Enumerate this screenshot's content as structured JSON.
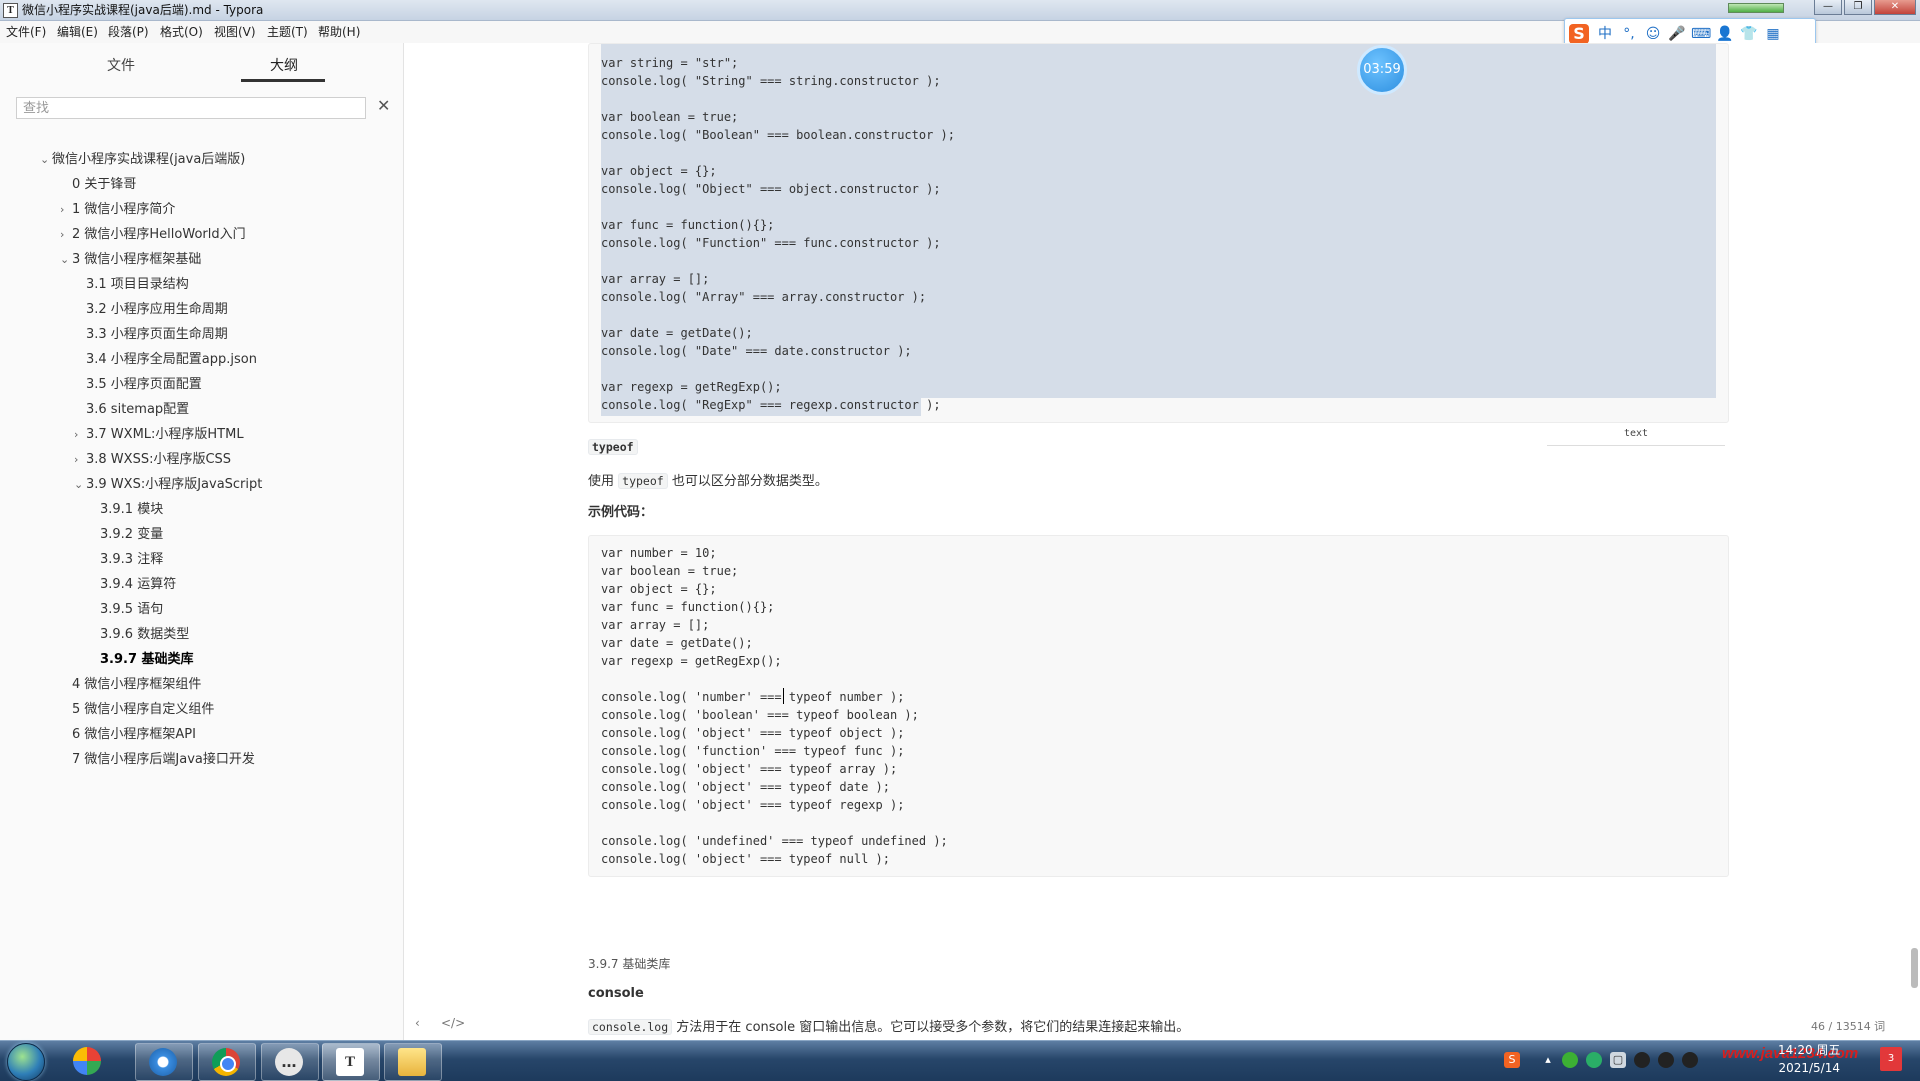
{
  "window": {
    "title": "微信小程序实战课程(java后端).md - Typora",
    "app_icon": "T",
    "controls": [
      "—",
      "❐",
      "✕"
    ]
  },
  "menu": [
    "文件(F)",
    "编辑(E)",
    "段落(P)",
    "格式(O)",
    "视图(V)",
    "主题(T)",
    "帮助(H)"
  ],
  "ime": {
    "items": [
      "S",
      "中",
      "°,",
      "☺",
      "🎤",
      "⌨",
      "👤",
      "👕",
      "▦"
    ]
  },
  "sidebar": {
    "tabs": [
      "文件",
      "大纲"
    ],
    "active_tab": "大纲",
    "search_placeholder": "查找",
    "search_clear": "✕",
    "outline": [
      {
        "label": "微信小程序实战课程(java后端版)",
        "level": 0,
        "chevron": "⌄"
      },
      {
        "label": "0 关于锋哥",
        "level": 1,
        "chevron": ""
      },
      {
        "label": "1 微信小程序简介",
        "level": 1,
        "chevron": "›"
      },
      {
        "label": "2 微信小程序HelloWorld入门",
        "level": 1,
        "chevron": "›"
      },
      {
        "label": "3 微信小程序框架基础",
        "level": 1,
        "chevron": "⌄"
      },
      {
        "label": "3.1 项目目录结构",
        "level": 2,
        "chevron": ""
      },
      {
        "label": "3.2 小程序应用生命周期",
        "level": 2,
        "chevron": ""
      },
      {
        "label": "3.3 小程序页面生命周期",
        "level": 2,
        "chevron": ""
      },
      {
        "label": "3.4 小程序全局配置app.json",
        "level": 2,
        "chevron": ""
      },
      {
        "label": "3.5 小程序页面配置",
        "level": 2,
        "chevron": ""
      },
      {
        "label": "3.6 sitemap配置",
        "level": 2,
        "chevron": ""
      },
      {
        "label": "3.7 WXML:小程序版HTML",
        "level": 2,
        "chevron": "›"
      },
      {
        "label": "3.8 WXSS:小程序版CSS",
        "level": 2,
        "chevron": "›"
      },
      {
        "label": "3.9 WXS:小程序版JavaScript",
        "level": 2,
        "chevron": "⌄"
      },
      {
        "label": "3.9.1 模块",
        "level": 3,
        "chevron": ""
      },
      {
        "label": "3.9.2 变量",
        "level": 3,
        "chevron": ""
      },
      {
        "label": "3.9.3 注释",
        "level": 3,
        "chevron": ""
      },
      {
        "label": "3.9.4 运算符",
        "level": 3,
        "chevron": ""
      },
      {
        "label": "3.9.5 语句",
        "level": 3,
        "chevron": ""
      },
      {
        "label": "3.9.6 数据类型",
        "level": 3,
        "chevron": ""
      },
      {
        "label": "3.9.7 基础类库",
        "level": 3,
        "chevron": "",
        "active": true
      },
      {
        "label": "4 微信小程序框架组件",
        "level": 1,
        "chevron": ""
      },
      {
        "label": "5 微信小程序自定义组件",
        "level": 1,
        "chevron": ""
      },
      {
        "label": "6 微信小程序框架API",
        "level": 1,
        "chevron": ""
      },
      {
        "label": "7 微信小程序后端Java接口开发",
        "level": 1,
        "chevron": ""
      }
    ]
  },
  "editor": {
    "timer": "03:59",
    "code_block_1": [
      "var string = \"str\";",
      "console.log( \"String\" === string.constructor );",
      "",
      "var boolean = true;",
      "console.log( \"Boolean\" === boolean.constructor );",
      "",
      "var object = {};",
      "console.log( \"Object\" === object.constructor );",
      "",
      "var func = function(){};",
      "console.log( \"Function\" === func.constructor );",
      "",
      "var array = [];",
      "console.log( \"Array\" === array.constructor );",
      "",
      "var date = getDate();",
      "console.log( \"Date\" === date.constructor );",
      "",
      "var regexp = getRegExp();",
      "console.log( \"RegExp\" === regexp.constructor );"
    ],
    "code_lang": "text",
    "heading_typeof": "typeof",
    "para_typeof_prefix": "使用 ",
    "para_typeof_code": "typeof",
    "para_typeof_suffix": " 也可以区分部分数据类型。",
    "sample_label": "示例代码：",
    "code_block_2": [
      "var number = 10;",
      "var boolean = true;",
      "var object = {};",
      "var func = function(){};",
      "var array = [];",
      "var date = getDate();",
      "var regexp = getRegExp();",
      "",
      "console.log( 'number' === typeof number );",
      "console.log( 'boolean' === typeof boolean );",
      "console.log( 'object' === typeof object );",
      "console.log( 'function' === typeof func );",
      "console.log( 'object' === typeof array );",
      "console.log( 'object' === typeof date );",
      "console.log( 'object' === typeof regexp );",
      "",
      "console.log( 'undefined' === typeof undefined );",
      "console.log( 'object' === typeof null );"
    ],
    "heading_basic_lib": "3.9.7 基础类库",
    "heading_console": "console",
    "para_console_code": "console.log",
    "para_console_text": " 方法用于在 console 窗口输出信息。它可以接受多个参数，将它们的结果连接起来输出。",
    "footer_left_icon": "‹",
    "footer_source_icon": "</>",
    "word_count": "46 / 13514 词"
  },
  "taskbar": {
    "apps": [
      "QQ浏览器",
      "Chrome",
      "微信",
      "T",
      "文件夹"
    ],
    "clock_time": "14:20 周五",
    "clock_date": "2021/5/14",
    "watermark": "www.java1234.com",
    "show_desktop": "3"
  }
}
